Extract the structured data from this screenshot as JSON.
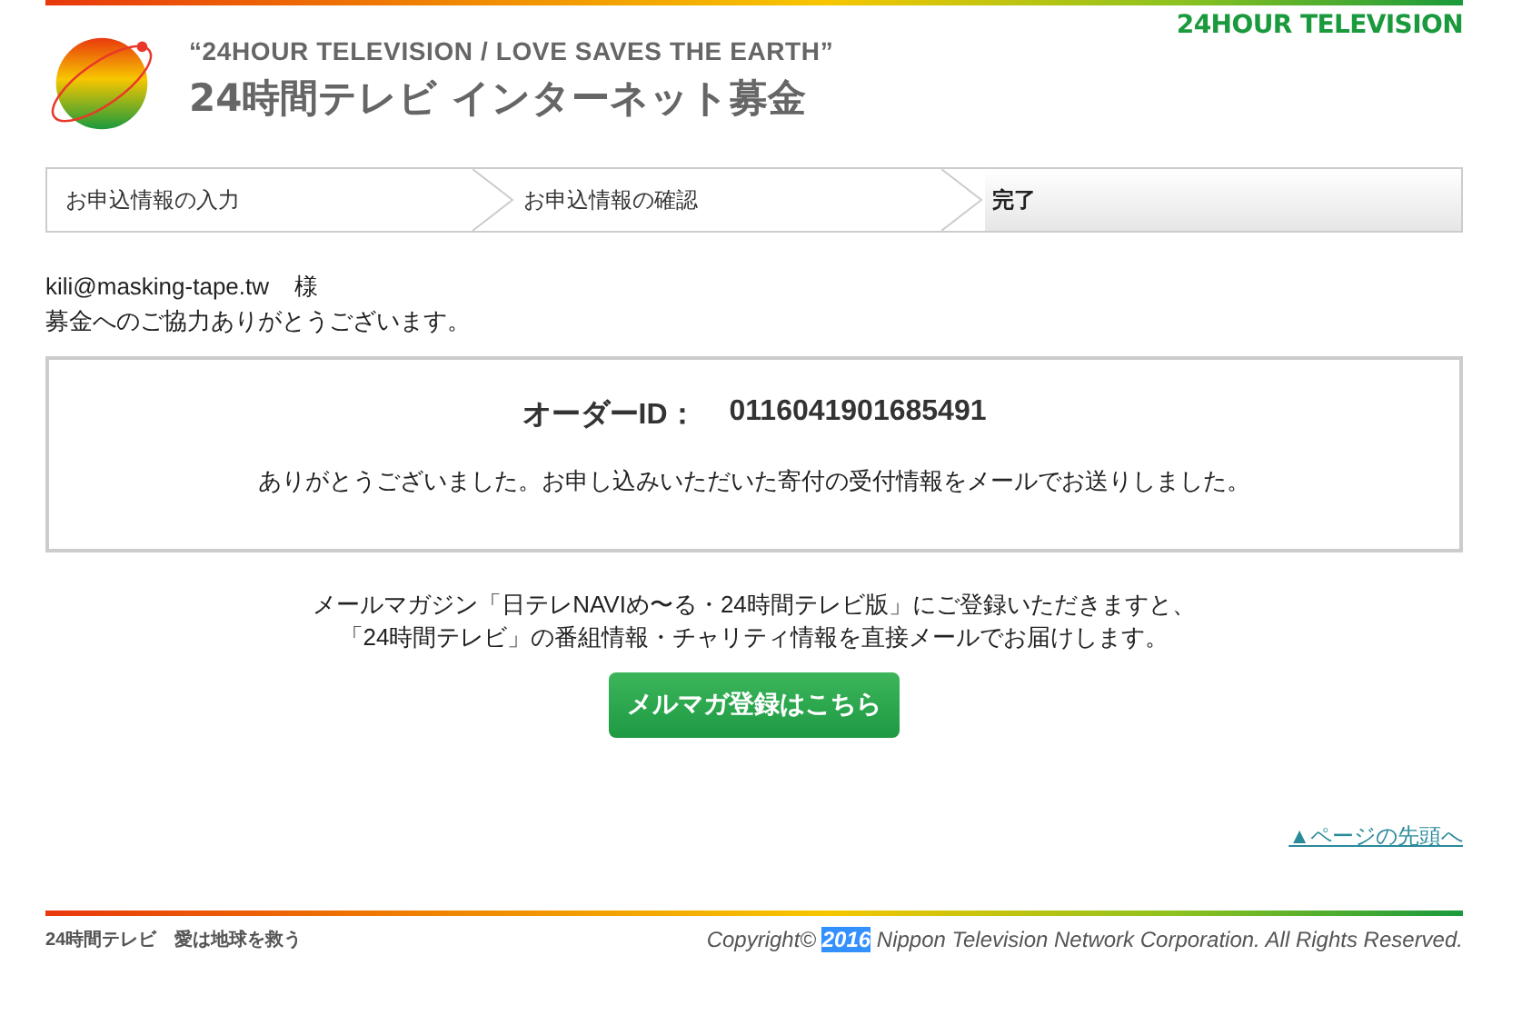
{
  "header": {
    "tagline": "“24HOUR TELEVISION / LOVE SAVES THE EARTH”",
    "title": "24時間テレビ インターネット募金",
    "brand": "24HOUR TELEVISION"
  },
  "steps": [
    {
      "label": "お申込情報の入力",
      "selected": false
    },
    {
      "label": "お申込情報の確認",
      "selected": false
    },
    {
      "label": "完了",
      "selected": true
    }
  ],
  "greeting": {
    "email": "kili@masking-tape.tw",
    "honorific": "様",
    "thanks": "募金へのご協力ありがとうございます。"
  },
  "order": {
    "label": "オーダーID：",
    "id": "0116041901685491",
    "message": "ありがとうございました。お申し込みいただいた寄付の受付情報をメールでお送りしました。"
  },
  "newsletter": {
    "lines": [
      "メールマガジン「日テレNAVIめ〜る・24時間テレビ版」にご登録いただきますと、",
      "「24時間テレビ」の番組情報・チャリティ情報を直接メールでお届けします。"
    ],
    "button": "メルマガ登録はこちら"
  },
  "page_top_link": "▲ページの先頭へ",
  "footer": {
    "tagline": "24時間テレビ　愛は地球を救う",
    "copyright_before": "Copyright© ",
    "year": "2016",
    "year_highlighted": true,
    "copyright_after": " Nippon Television Network Corporation. All Rights Reserved."
  }
}
